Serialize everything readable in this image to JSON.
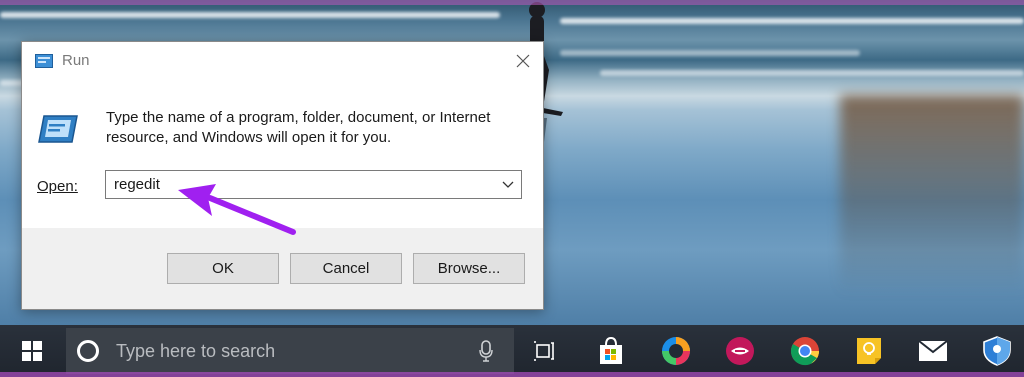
{
  "dialog": {
    "title": "Run",
    "description": "Type the name of a program, folder, document, or Internet resource, and Windows will open it for you.",
    "open_label": "Open:",
    "open_value": "regedit",
    "buttons": {
      "ok": "OK",
      "cancel": "Cancel",
      "browse": "Browse..."
    }
  },
  "taskbar": {
    "search_placeholder": "Type here to search",
    "icons": [
      "start-icon",
      "cortana-icon",
      "microphone-icon",
      "task-view-icon",
      "store-icon",
      "edge-canary-icon",
      "app-icon",
      "chrome-icon",
      "sticky-notes-icon",
      "mail-icon",
      "shield-icon"
    ]
  },
  "colors": {
    "annotation_arrow": "#a020f0",
    "taskbar": "#222a35",
    "dialog_bg": "#f0f0f0"
  }
}
